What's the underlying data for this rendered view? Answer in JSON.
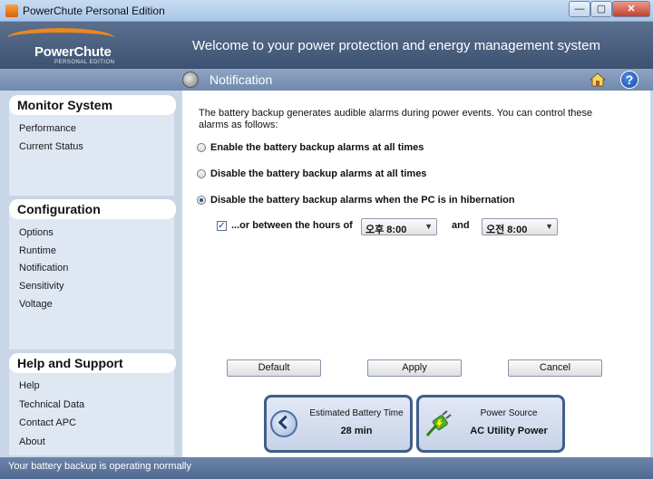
{
  "window": {
    "title": "PowerChute Personal Edition"
  },
  "header": {
    "logo_text": "PowerChute",
    "logo_sub": "PERSONAL EDITION",
    "welcome": "Welcome to your power protection and energy management system"
  },
  "page": {
    "title": "Notification"
  },
  "sidebar": {
    "sections": [
      {
        "title": "Monitor System",
        "items": [
          {
            "label": "Performance"
          },
          {
            "label": "Current Status"
          }
        ]
      },
      {
        "title": "Configuration",
        "items": [
          {
            "label": "Options"
          },
          {
            "label": "Runtime"
          },
          {
            "label": "Notification"
          },
          {
            "label": "Sensitivity"
          },
          {
            "label": "Voltage"
          }
        ]
      },
      {
        "title": "Help and Support",
        "items": [
          {
            "label": "Help"
          },
          {
            "label": "Technical Data"
          },
          {
            "label": "Contact APC"
          },
          {
            "label": "About"
          }
        ]
      }
    ]
  },
  "main": {
    "intro": "The battery backup generates audible alarms during power events. You can control these alarms as follows:",
    "options": [
      {
        "label": "Enable the battery backup alarms at all times",
        "selected": false
      },
      {
        "label": "Disable the battery backup alarms at all times",
        "selected": false
      },
      {
        "label": "Disable the battery backup alarms when the PC is in hibernation",
        "selected": true
      }
    ],
    "hours": {
      "checked": true,
      "label": "...or between the hours of",
      "from": "오후 8:00",
      "and_label": "and",
      "to": "오전 8:00"
    },
    "buttons": {
      "default": "Default",
      "apply": "Apply",
      "cancel": "Cancel"
    },
    "cards": {
      "battery": {
        "title": "Estimated Battery Time",
        "value": "28 min"
      },
      "power": {
        "title": "Power Source",
        "value": "AC Utility Power"
      }
    }
  },
  "footer": {
    "status": "Your battery backup is operating normally"
  },
  "icons": {
    "app": "app-icon",
    "speaker": "speaker-icon",
    "home": "home-icon",
    "help": "help-icon",
    "clock": "clock-icon",
    "plug": "plug-icon",
    "check": "✓",
    "caret": "▼",
    "minimize": "—",
    "maximize": "▢",
    "close": "✕",
    "help_glyph": "?"
  },
  "colors": {
    "accent": "#e7891f",
    "header": "#4a5e7e",
    "card_border": "#415d8b"
  }
}
